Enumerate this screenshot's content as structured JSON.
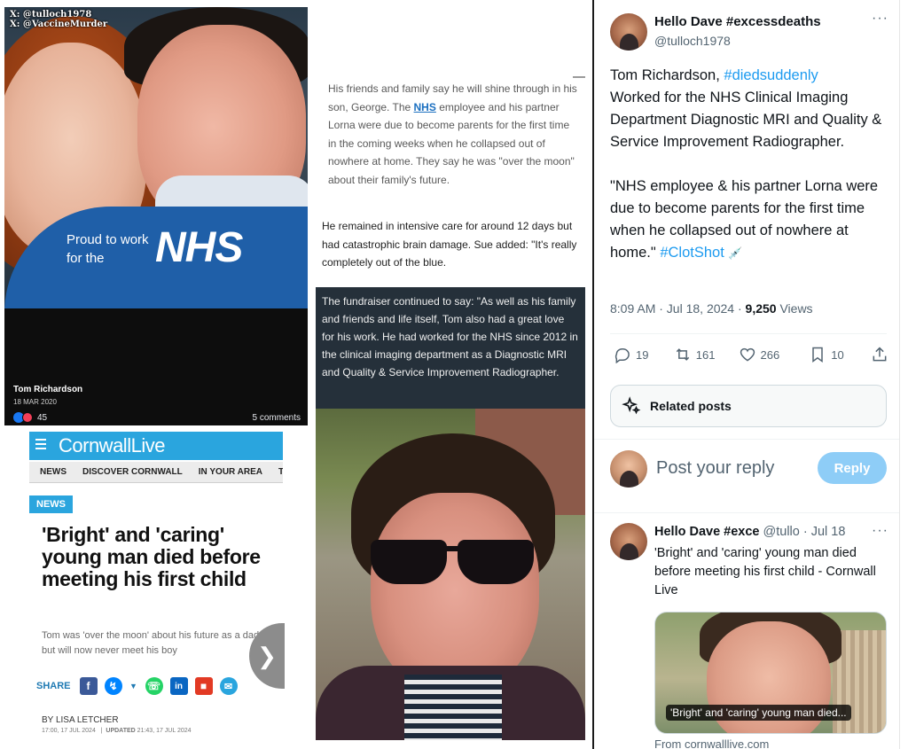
{
  "collage": {
    "watermark_1": "X: @tulloch1978",
    "watermark_2": "X: @VaccineMurder",
    "fb_post": {
      "banner_text": "Proud to work for the",
      "banner_logo": "NHS",
      "name": "Tom Richardson",
      "date": "18 MAR 2020",
      "reactions": "45",
      "comments": "5 comments"
    },
    "article_quote_before": "His friends and family say he will shine through in his son, George. The ",
    "article_quote_link": "NHS",
    "article_quote_after": " employee and his partner Lorna were due to become parents for the first time in the coming weeks when he collapsed out of nowhere at home. They say he was \"over the moon\" about their family's future.",
    "article_para": "He remained in intensive care for around 12 days but had catastrophic brain damage. Sue added: \"It's really completely out of the blue.",
    "dark_box_text": "The fundraiser continued to say: \"As well as his family and friends and life itself, Tom also had a great love for his work. He had worked for the NHS since 2012 in the clinical imaging department as a Diagnostic MRI and Quality & Service Improvement Radiographer.",
    "cornwall_live": {
      "logo": "CornwallLive",
      "nav": [
        "NEWS",
        "DISCOVER CORNWALL",
        "IN YOUR AREA",
        "TRUR"
      ],
      "badge": "NEWS",
      "headline": "'Bright' and 'caring' young man died before meeting his first child",
      "standfirst": "Tom was 'over the moon' about his future as a dad but will now never meet his boy",
      "share_label": "SHARE",
      "by_label": "BY",
      "author": "LISA LETCHER",
      "published": "17:00, 17 JUL 2024",
      "updated_label": "UPDATED",
      "updated": "21:43, 17 JUL 2024"
    }
  },
  "tweet": {
    "author_name": "Hello Dave #excessdeaths",
    "author_handle": "@tulloch1978",
    "text_1": "Tom Richardson, ",
    "hashtag_1": "#diedsuddenly",
    "text_2": "\nWorked for the NHS Clinical Imaging Department Diagnostic MRI and Quality & Service Improvement Radiographer.\n\n\"NHS employee & his partner Lorna were due to become parents for the first time when he collapsed out of nowhere at home.\"  ",
    "hashtag_2": "#ClotShot",
    "emoji": "💉",
    "time": "8:09 AM · Jul 18, 2024 · ",
    "views_count": "9,250",
    "views_label": " Views",
    "replies": "19",
    "reposts": "161",
    "likes": "266",
    "bookmarks": "10",
    "related_label": "Related posts",
    "reply_placeholder": "Post your reply",
    "reply_button": "Reply"
  },
  "reply_tweet": {
    "author_name": "Hello Dave #exce",
    "handle_time": " @tullo · Jul 18",
    "text": "'Bright' and 'caring' young man died before meeting his first child - Cornwall Live",
    "card_caption": "'Bright' and 'caring' young man died...",
    "card_source": "From cornwalllive.com"
  },
  "colors": {
    "twitter_blue": "#1d9bf0",
    "nhs_blue": "#1f5fa8",
    "cornwall_live_blue": "#2aa5de",
    "reply_button_disabled": "#8ecdf7"
  },
  "icons": [
    "more-icon",
    "reply-icon",
    "repost-icon",
    "like-icon",
    "bookmark-icon",
    "share-icon",
    "sparkle-icon",
    "menu-icon",
    "chevron-right-icon",
    "facebook-icon",
    "messenger-icon",
    "whatsapp-icon",
    "linkedin-icon",
    "flipboard-icon",
    "email-icon"
  ]
}
